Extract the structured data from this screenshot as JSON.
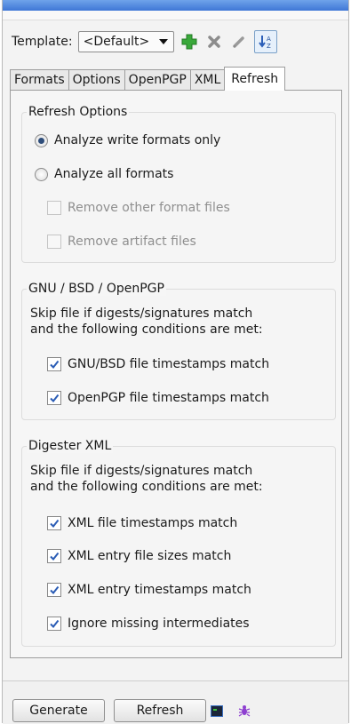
{
  "template": {
    "label": "Template:",
    "selected": "<Default>",
    "icons": [
      "add-icon",
      "delete-icon",
      "edit-icon",
      "sort-icon"
    ]
  },
  "tabs": [
    {
      "label": "Formats",
      "active": false
    },
    {
      "label": "Options",
      "active": false
    },
    {
      "label": "OpenPGP",
      "active": false
    },
    {
      "label": "XML",
      "active": false
    },
    {
      "label": "Refresh",
      "active": true
    }
  ],
  "refresh_options": {
    "title": "Refresh Options",
    "radios": [
      {
        "label": "Analyze write formats only",
        "selected": true
      },
      {
        "label": "Analyze all formats",
        "selected": false
      }
    ],
    "checks": [
      {
        "label": "Remove other format files",
        "checked": false,
        "enabled": false
      },
      {
        "label": "Remove artifact files",
        "checked": false,
        "enabled": false
      }
    ]
  },
  "gnu_group": {
    "title": "GNU / BSD / OpenPGP",
    "desc1": "Skip file if digests/signatures match",
    "desc2": "and the following conditions are met:",
    "checks": [
      {
        "label": "GNU/BSD file timestamps match",
        "checked": true
      },
      {
        "label": "OpenPGP file timestamps match",
        "checked": true
      }
    ]
  },
  "xml_group": {
    "title": "Digester XML",
    "desc1": "Skip file if digests/signatures match",
    "desc2": "and the following conditions are met:",
    "checks": [
      {
        "label": "XML file timestamps match",
        "checked": true
      },
      {
        "label": "XML entry file sizes match",
        "checked": true
      },
      {
        "label": "XML entry timestamps match",
        "checked": true
      },
      {
        "label": "Ignore missing intermediates",
        "checked": true
      }
    ]
  },
  "buttons": {
    "generate": "Generate",
    "refresh": "Refresh"
  },
  "status_icons": [
    "terminal-icon",
    "bug-icon"
  ],
  "colors": {
    "accent": "#3f77d6",
    "check": "#2a5cb5",
    "add_green": "#2fa12f"
  }
}
